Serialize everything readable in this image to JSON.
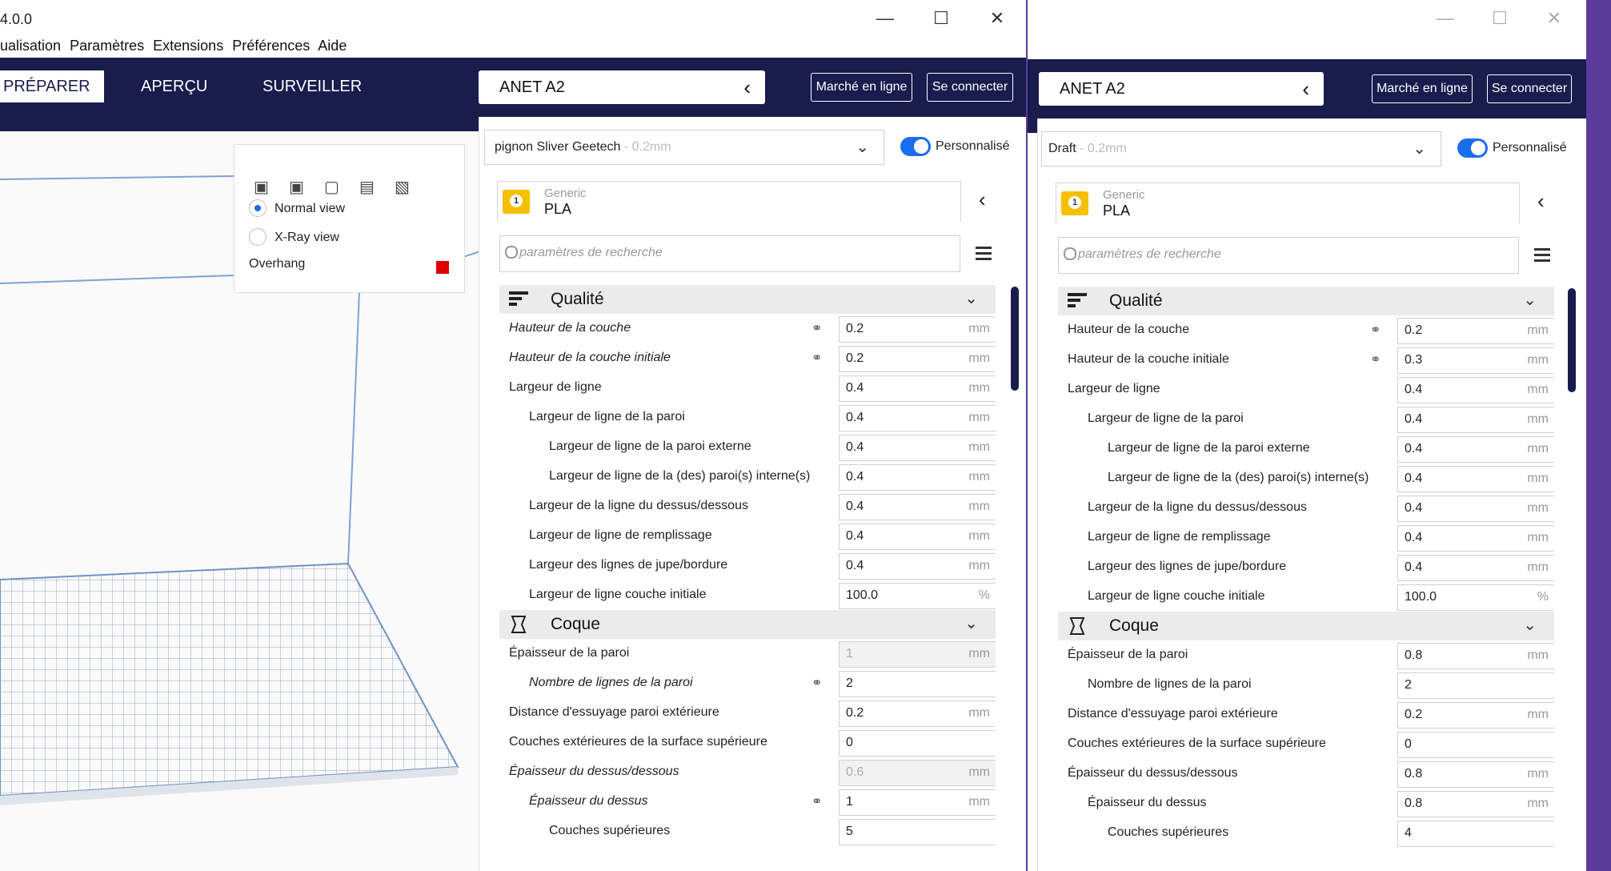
{
  "window1": {
    "title": "4.0.0",
    "menu": [
      "ualisation",
      "Paramètres",
      "Extensions",
      "Préférences",
      "Aide"
    ],
    "tabs": [
      {
        "label": "PRÉPARER",
        "active": true
      },
      {
        "label": "APERÇU",
        "active": false
      },
      {
        "label": "SURVEILLER",
        "active": false
      }
    ],
    "printer": "ANET A2",
    "marketplace": "Marché en ligne",
    "signin": "Se connecter",
    "profile_name": "pignon Sliver Geetech",
    "profile_layer": " - 0.2mm",
    "custom_label": "Personnalisé",
    "material_brand": "Generic",
    "material_name": "PLA",
    "search_placeholder": "paramètres de recherche",
    "view": {
      "normal": "Normal view",
      "xray": "X-Ray view",
      "overhang": "Overhang",
      "overhang_color": "#e00000"
    },
    "categories": {
      "quality": "Qualité",
      "shell": "Coque"
    },
    "quality_rows": [
      {
        "label": "Hauteur de la couche",
        "value": "0.2",
        "unit": "mm",
        "indent": 0,
        "italic": true,
        "link": true,
        "disabled": false
      },
      {
        "label": "Hauteur de la couche initiale",
        "value": "0.2",
        "unit": "mm",
        "indent": 0,
        "italic": true,
        "link": true,
        "disabled": false
      },
      {
        "label": "Largeur de ligne",
        "value": "0.4",
        "unit": "mm",
        "indent": 0,
        "italic": false,
        "link": false,
        "disabled": false
      },
      {
        "label": "Largeur de ligne de la paroi",
        "value": "0.4",
        "unit": "mm",
        "indent": 1,
        "italic": false,
        "link": false,
        "disabled": false
      },
      {
        "label": "Largeur de ligne de la paroi externe",
        "value": "0.4",
        "unit": "mm",
        "indent": 2,
        "italic": false,
        "link": false,
        "disabled": false
      },
      {
        "label": "Largeur de ligne de la (des) paroi(s) interne(s)",
        "value": "0.4",
        "unit": "mm",
        "indent": 2,
        "italic": false,
        "link": false,
        "disabled": false
      },
      {
        "label": "Largeur de la ligne du dessus/dessous",
        "value": "0.4",
        "unit": "mm",
        "indent": 1,
        "italic": false,
        "link": false,
        "disabled": false
      },
      {
        "label": "Largeur de ligne de remplissage",
        "value": "0.4",
        "unit": "mm",
        "indent": 1,
        "italic": false,
        "link": false,
        "disabled": false
      },
      {
        "label": "Largeur des lignes de jupe/bordure",
        "value": "0.4",
        "unit": "mm",
        "indent": 1,
        "italic": false,
        "link": false,
        "disabled": false
      },
      {
        "label": "Largeur de ligne couche initiale",
        "value": "100.0",
        "unit": "%",
        "indent": 1,
        "italic": false,
        "link": false,
        "disabled": false
      }
    ],
    "shell_rows": [
      {
        "label": "Épaisseur de la paroi",
        "value": "1",
        "unit": "mm",
        "indent": 0,
        "italic": false,
        "link": false,
        "disabled": true
      },
      {
        "label": "Nombre de lignes de la paroi",
        "value": "2",
        "unit": "",
        "indent": 1,
        "italic": true,
        "link": true,
        "disabled": false
      },
      {
        "label": "Distance d'essuyage paroi extérieure",
        "value": "0.2",
        "unit": "mm",
        "indent": 0,
        "italic": false,
        "link": false,
        "disabled": false
      },
      {
        "label": "Couches extérieures de la surface supérieure",
        "value": "0",
        "unit": "",
        "indent": 0,
        "italic": false,
        "link": false,
        "disabled": false
      },
      {
        "label": "Épaisseur du dessus/dessous",
        "value": "0.6",
        "unit": "mm",
        "indent": 0,
        "italic": true,
        "link": false,
        "disabled": true
      },
      {
        "label": "Épaisseur du dessus",
        "value": "1",
        "unit": "mm",
        "indent": 1,
        "italic": true,
        "link": true,
        "disabled": false
      },
      {
        "label": "Couches supérieures",
        "value": "5",
        "unit": "",
        "indent": 2,
        "italic": false,
        "link": false,
        "disabled": false
      }
    ]
  },
  "window2": {
    "printer": "ANET A2",
    "marketplace": "Marché en ligne",
    "signin": "Se connecter",
    "profile_name": "Draft",
    "profile_layer": " - 0.2mm",
    "custom_label": "Personnalisé",
    "material_brand": "Generic",
    "material_name": "PLA",
    "search_placeholder": "paramètres de recherche",
    "categories": {
      "quality": "Qualité",
      "shell": "Coque"
    },
    "quality_rows": [
      {
        "label": "Hauteur de la couche",
        "value": "0.2",
        "unit": "mm",
        "indent": 0,
        "italic": false,
        "link": true,
        "disabled": false
      },
      {
        "label": "Hauteur de la couche initiale",
        "value": "0.3",
        "unit": "mm",
        "indent": 0,
        "italic": false,
        "link": true,
        "disabled": false
      },
      {
        "label": "Largeur de ligne",
        "value": "0.4",
        "unit": "mm",
        "indent": 0,
        "italic": false,
        "link": false,
        "disabled": false
      },
      {
        "label": "Largeur de ligne de la paroi",
        "value": "0.4",
        "unit": "mm",
        "indent": 1,
        "italic": false,
        "link": false,
        "disabled": false
      },
      {
        "label": "Largeur de ligne de la paroi externe",
        "value": "0.4",
        "unit": "mm",
        "indent": 2,
        "italic": false,
        "link": false,
        "disabled": false
      },
      {
        "label": "Largeur de ligne de la (des) paroi(s) interne(s)",
        "value": "0.4",
        "unit": "mm",
        "indent": 2,
        "italic": false,
        "link": false,
        "disabled": false
      },
      {
        "label": "Largeur de la ligne du dessus/dessous",
        "value": "0.4",
        "unit": "mm",
        "indent": 1,
        "italic": false,
        "link": false,
        "disabled": false
      },
      {
        "label": "Largeur de ligne de remplissage",
        "value": "0.4",
        "unit": "mm",
        "indent": 1,
        "italic": false,
        "link": false,
        "disabled": false
      },
      {
        "label": "Largeur des lignes de jupe/bordure",
        "value": "0.4",
        "unit": "mm",
        "indent": 1,
        "italic": false,
        "link": false,
        "disabled": false
      },
      {
        "label": "Largeur de ligne couche initiale",
        "value": "100.0",
        "unit": "%",
        "indent": 1,
        "italic": false,
        "link": false,
        "disabled": false
      }
    ],
    "shell_rows": [
      {
        "label": "Épaisseur de la paroi",
        "value": "0.8",
        "unit": "mm",
        "indent": 0,
        "italic": false,
        "link": false,
        "disabled": false
      },
      {
        "label": "Nombre de lignes de la paroi",
        "value": "2",
        "unit": "",
        "indent": 1,
        "italic": false,
        "link": false,
        "disabled": false
      },
      {
        "label": "Distance d'essuyage paroi extérieure",
        "value": "0.2",
        "unit": "mm",
        "indent": 0,
        "italic": false,
        "link": false,
        "disabled": false
      },
      {
        "label": "Couches extérieures de la surface supérieure",
        "value": "0",
        "unit": "",
        "indent": 0,
        "italic": false,
        "link": false,
        "disabled": false
      },
      {
        "label": "Épaisseur du dessus/dessous",
        "value": "0.8",
        "unit": "mm",
        "indent": 0,
        "italic": false,
        "link": false,
        "disabled": false
      },
      {
        "label": "Épaisseur du dessus",
        "value": "0.8",
        "unit": "mm",
        "indent": 1,
        "italic": false,
        "link": false,
        "disabled": false
      },
      {
        "label": "Couches supérieures",
        "value": "4",
        "unit": "",
        "indent": 2,
        "italic": false,
        "link": false,
        "disabled": false
      }
    ]
  },
  "colors": {
    "header": "#191c4c",
    "accent": "#196ef0",
    "material": "#f5c000",
    "desktop": "#5b3c9a"
  }
}
